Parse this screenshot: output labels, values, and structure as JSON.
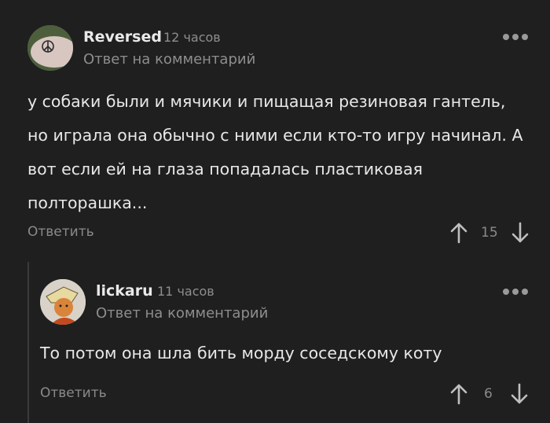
{
  "comments": [
    {
      "username": "Reversed",
      "time": "12 часов",
      "reply_to": "Ответ на комментарий",
      "text": "у собаки были и мячики и пищащая резиновая гантель, но играла она обычно с ними если кто-то игру начинал. А вот если ей на глаза попадалась пластиковая полторашка...",
      "reply_label": "Ответить",
      "votes": "15"
    },
    {
      "username": "lickaru",
      "time": "11 часов",
      "reply_to": "Ответ на комментарий",
      "text": "То потом она шла бить морду соседскому коту",
      "reply_label": "Ответить",
      "votes": "6"
    }
  ],
  "icons": {
    "more": "more-dots-icon",
    "upvote": "arrow-up-icon",
    "downvote": "arrow-down-icon"
  },
  "colors": {
    "background": "#1f1f1f",
    "text": "#e8e8e8",
    "muted": "#8e8e8e"
  }
}
